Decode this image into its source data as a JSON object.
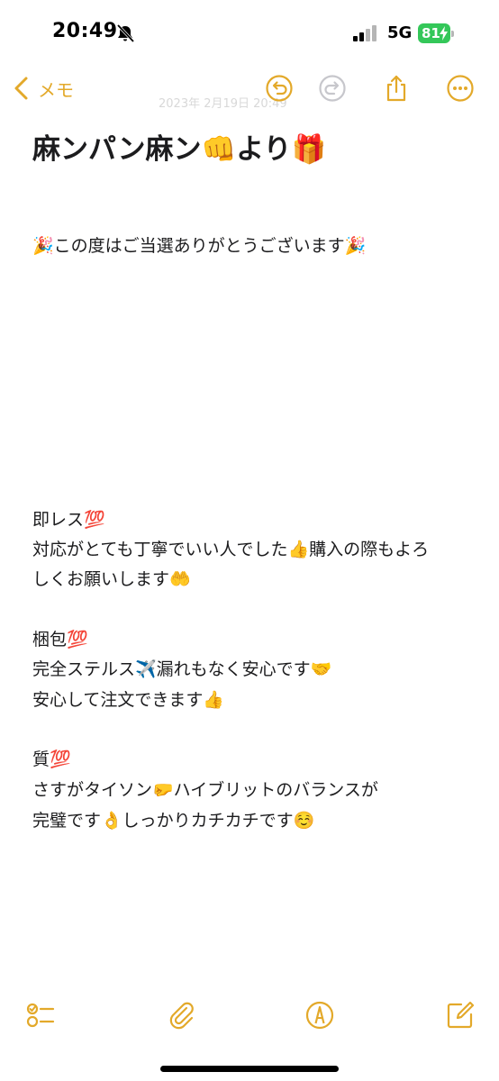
{
  "status_bar": {
    "time": "20:49",
    "network": "5G",
    "battery": "81"
  },
  "nav": {
    "back_label": "メモ",
    "faint_date": "2023年 2月19日 20:49"
  },
  "note": {
    "title": "麻ンパン麻ン👊より🎁",
    "greeting": "🎉この度はご当選ありがとうございます🎉",
    "sections": [
      {
        "heading": "即レス💯",
        "lines": [
          "対応がとても丁寧でいい人でした👍購入の際もよろ",
          "しくお願いします🤲"
        ]
      },
      {
        "heading": "梱包💯",
        "lines": [
          "完全ステルス✈️漏れもなく安心です🤝",
          "安心して注文できます👍"
        ]
      },
      {
        "heading": "質💯",
        "lines": [
          "さすがタイソン🤛ハイブリットのバランスが",
          "完璧です👌しっかりカチカチです☺️"
        ]
      }
    ]
  },
  "icons": {
    "bell": "bell-slash-icon",
    "undo": "undo-icon",
    "redo": "redo-icon",
    "share": "share-icon",
    "more": "more-icon",
    "checklist": "checklist-icon",
    "attach": "paperclip-icon",
    "markup": "markup-pen-icon",
    "compose": "compose-icon"
  },
  "colors": {
    "accent": "#e3a92a",
    "battery": "#34c759",
    "text": "#1c1c1e",
    "redo_disabled": "#c7c7cc"
  }
}
